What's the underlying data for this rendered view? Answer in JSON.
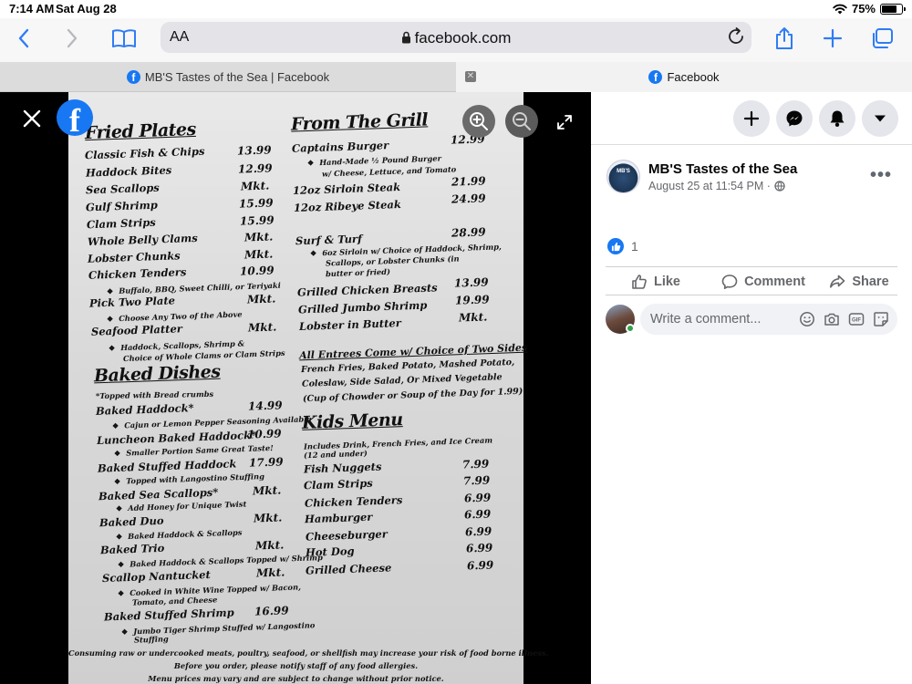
{
  "status_bar": {
    "time": "7:14 AM",
    "date": "Sat Aug 28",
    "battery": "75%",
    "battery_level": 0.75
  },
  "browser": {
    "aa_label": "AA",
    "url": "facebook.com",
    "tabs": [
      {
        "title": "MB'S Tastes of the Sea | Facebook",
        "active": false
      },
      {
        "title": "Facebook",
        "active": true
      }
    ]
  },
  "viewer": {
    "fb_letter": "f"
  },
  "menu": {
    "fried": {
      "heading": "Fried Plates",
      "items": [
        {
          "name": "Classic Fish & Chips",
          "price": "13.99"
        },
        {
          "name": "Haddock Bites",
          "price": "12.99"
        },
        {
          "name": "Sea Scallops",
          "price": "Mkt."
        },
        {
          "name": "Gulf Shrimp",
          "price": "15.99"
        },
        {
          "name": "Clam Strips",
          "price": "15.99"
        },
        {
          "name": "Whole Belly Clams",
          "price": "Mkt."
        },
        {
          "name": "Lobster Chunks",
          "price": "Mkt."
        },
        {
          "name": "Chicken Tenders",
          "price": "10.99"
        },
        {
          "name": "Pick Two Plate",
          "price": "Mkt."
        },
        {
          "name": "Seafood Platter",
          "price": "Mkt."
        }
      ],
      "notes": [
        "Buffalo, BBQ, Sweet Chilli, or Teriyaki",
        "Choose Any Two of the Above",
        "Haddock, Scallops, Shrimp &",
        "Choice of Whole Clams or Clam Strips"
      ]
    },
    "baked": {
      "heading": "Baked Dishes",
      "subnote": "*Topped with Bread crumbs",
      "items": [
        {
          "name": "Baked Haddock*",
          "price": "14.99"
        },
        {
          "name": "Luncheon Baked Haddock*",
          "price": "10.99"
        },
        {
          "name": "Baked Stuffed Haddock",
          "price": "17.99"
        },
        {
          "name": "Baked Sea Scallops*",
          "price": "Mkt."
        },
        {
          "name": "Baked Duo",
          "price": "Mkt."
        },
        {
          "name": "Baked Trio",
          "price": "Mkt."
        },
        {
          "name": "Scallop Nantucket",
          "price": "Mkt."
        },
        {
          "name": "Baked Stuffed Shrimp",
          "price": "16.99"
        }
      ],
      "notes": [
        "Cajun or Lemon Pepper Seasoning Available",
        "Smaller Portion Same Great Taste!",
        "Topped with Langostino Stuffing",
        "Add Honey for Unique Twist",
        "Baked Haddock & Scallops",
        "Baked Haddock & Scallops Topped w/ Shrimp",
        "Cooked in White Wine Topped w/ Bacon,",
        "Tomato, and Cheese",
        "Jumbo Tiger Shrimp Stuffed w/ Langostino",
        "Stuffing"
      ]
    },
    "grill": {
      "heading": "From The Grill",
      "items": [
        {
          "name": "Captains Burger",
          "price": "12.99"
        },
        {
          "name": "12oz Sirloin Steak",
          "price": "21.99"
        },
        {
          "name": "12oz Ribeye Steak",
          "price": "24.99"
        },
        {
          "name": "Surf & Turf",
          "price": "28.99"
        },
        {
          "name": "Grilled Chicken Breasts",
          "price": "13.99"
        },
        {
          "name": "Grilled Jumbo Shrimp",
          "price": "19.99"
        },
        {
          "name": "Lobster in Butter",
          "price": "Mkt."
        }
      ],
      "notes": [
        "Hand-Made ½ Pound Burger",
        "w/ Cheese, Lettuce, and Tomato",
        "6oz Sirloin w/ Choice of Haddock, Shrimp,",
        "Scallops, or Lobster Chunks (in",
        "butter or fried)"
      ]
    },
    "sides": {
      "heading": "All Entrees Come w/ Choice of Two Sides",
      "lines": [
        "French Fries, Baked Potato, Mashed Potato,",
        "Coleslaw, Side Salad, Or Mixed Vegetable",
        "(Cup of Chowder or Soup of the Day for 1.99)"
      ]
    },
    "kids": {
      "heading": "Kids Menu",
      "notes": [
        "Includes Drink, French Fries, and Ice Cream",
        "(12 and under)"
      ],
      "items": [
        {
          "name": "Fish Nuggets",
          "price": "7.99"
        },
        {
          "name": "Clam Strips",
          "price": "7.99"
        },
        {
          "name": "Chicken Tenders",
          "price": "6.99"
        },
        {
          "name": "Hamburger",
          "price": "6.99"
        },
        {
          "name": "Cheeseburger",
          "price": "6.99"
        },
        {
          "name": "Hot Dog",
          "price": "6.99"
        },
        {
          "name": "Grilled Cheese",
          "price": "6.99"
        }
      ]
    },
    "footer": [
      "Consuming raw or undercooked meats, poultry, seafood, or shellfish may increase your risk of food borne illness.",
      "Before you order, please notify staff of any food allergies.",
      "Menu prices may vary and are subject to change without prior notice."
    ]
  },
  "post": {
    "page_name": "MB'S Tastes of the Sea",
    "avatar_text": "MB'S",
    "meta": "August 25 at 11:54 PM ·",
    "like_count": "1",
    "actions": {
      "like": "Like",
      "comment": "Comment",
      "share": "Share"
    },
    "comment_placeholder": "Write a comment..."
  },
  "colors": {
    "facebook_blue": "#1877f2",
    "safari_blue": "#2f7cf6",
    "online_green": "#31a24c"
  }
}
